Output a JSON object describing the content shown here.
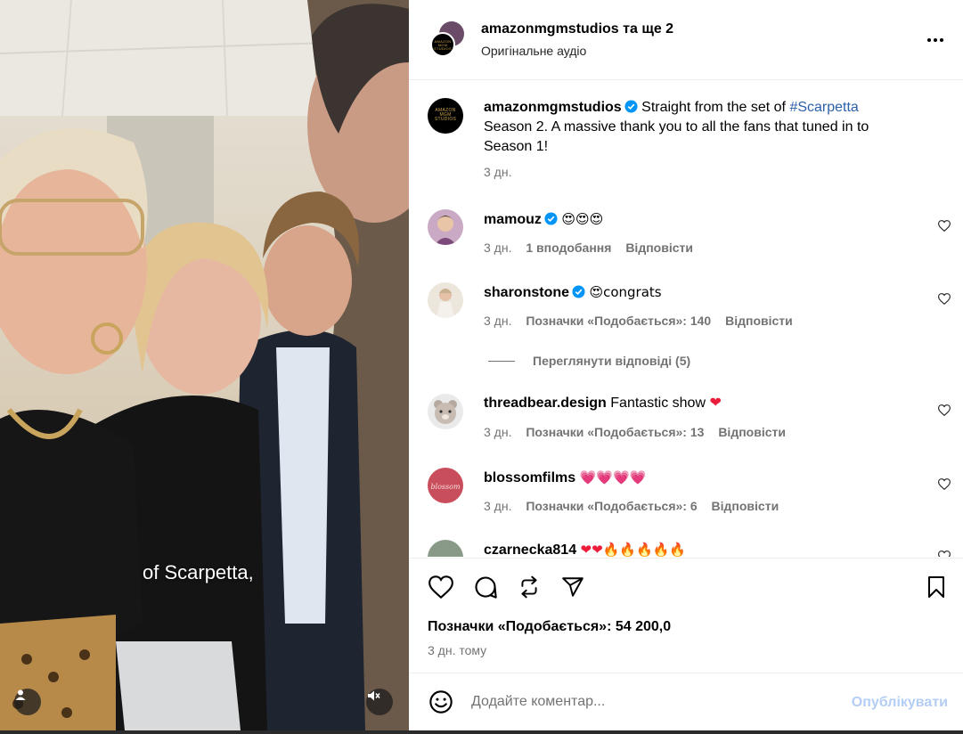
{
  "media": {
    "caption_overlay": "of Scarpetta,",
    "user_tag_icon": "person-icon",
    "mute_icon": "speaker-muted-icon"
  },
  "header": {
    "username": "amazonmgmstudios",
    "coauthors": "та ще 2",
    "audio": "Оригінальне аудіо",
    "logo_text": [
      "AMAZON",
      "MGM",
      "STUDIOS"
    ],
    "more_icon": "more-dots-icon"
  },
  "post": {
    "username": "amazonmgmstudios",
    "caption_pre": "Straight from the set of ",
    "hashtag": "#Scarpetta",
    "caption_post": " Season 2. A massive thank you to all the fans that tuned in to Season 1!",
    "time": "3 дн."
  },
  "comments": [
    {
      "username": "mamouz",
      "verified": true,
      "text": "😍😍😍",
      "time": "3 дн.",
      "likes": "1 вподобання",
      "reply": "Відповісти"
    },
    {
      "username": "sharonstone",
      "verified": true,
      "text": "😍congrats",
      "time": "3 дн.",
      "likes": "Позначки «Подобається»: 140",
      "reply": "Відповісти"
    },
    {
      "username": "threadbear.design",
      "verified": false,
      "text": "Fantastic show ❤",
      "time": "3 дн.",
      "likes": "Позначки «Подобається»: 13",
      "reply": "Відповісти"
    },
    {
      "username": "blossomfilms",
      "verified": false,
      "text": "💗💗💗💗",
      "time": "3 дн.",
      "likes": "Позначки «Подобається»: 6",
      "reply": "Відповісти"
    },
    {
      "username": "czarnecka814",
      "verified": false,
      "text": "❤❤🔥🔥🔥🔥🔥",
      "time": "",
      "likes": "",
      "reply": ""
    }
  ],
  "view_replies": "Переглянути відповіді (5)",
  "actions": {
    "like_icon": "heart-icon",
    "comment_icon": "comment-icon",
    "repost_icon": "repost-icon",
    "share_icon": "send-icon",
    "save_icon": "bookmark-icon",
    "likes_count": "Позначки «Подобається»: 54 200,0",
    "posted_ago": "3 дн. тому"
  },
  "composer": {
    "placeholder": "Додайте коментар...",
    "publish": "Опублікувати",
    "emoji_icon": "smiley-icon"
  },
  "colors": {
    "accent_link": "#2b5fa8",
    "publish_disabled": "#b3cdf5",
    "heart_red": "#ed1c3a",
    "verified_blue": "#0095f6"
  }
}
